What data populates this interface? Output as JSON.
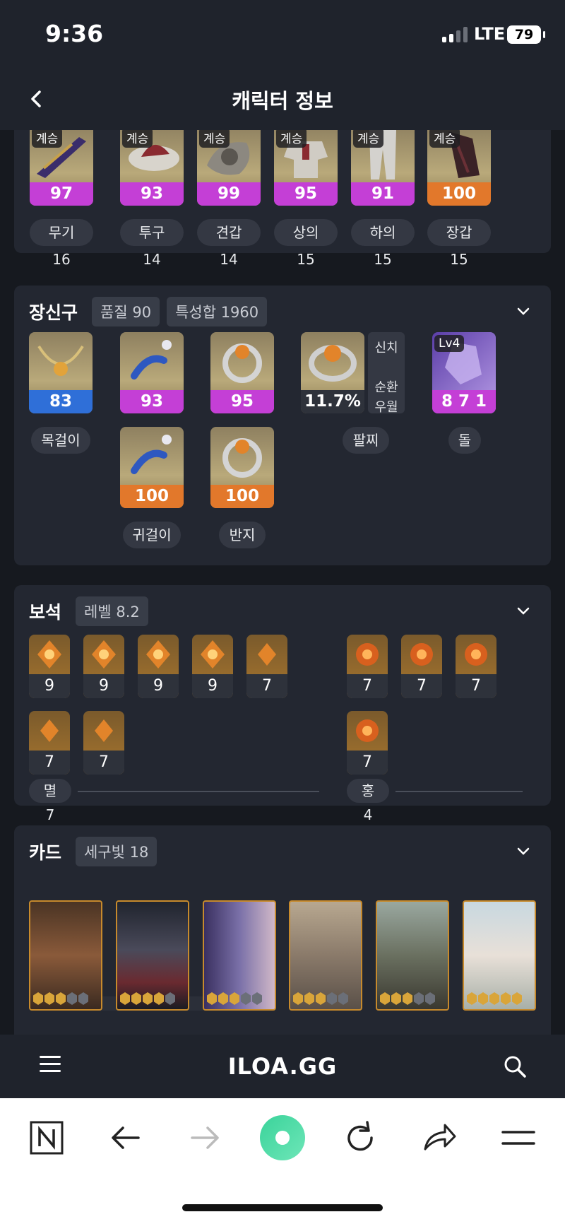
{
  "status": {
    "time": "9:36",
    "network": "LTE",
    "battery": "79"
  },
  "header": {
    "title": "캐릭터 정보"
  },
  "equipment": {
    "items": [
      {
        "badge": "계승",
        "quality": "97",
        "quality_color": "#c43fd6",
        "label": "무기 16"
      },
      {
        "badge": "계승",
        "quality": "93",
        "quality_color": "#c43fd6",
        "label": "투구 14"
      },
      {
        "badge": "계승",
        "quality": "99",
        "quality_color": "#c43fd6",
        "label": "견갑 14"
      },
      {
        "badge": "계승",
        "quality": "95",
        "quality_color": "#c43fd6",
        "label": "상의 15"
      },
      {
        "badge": "계승",
        "quality": "91",
        "quality_color": "#c43fd6",
        "label": "하의 15"
      },
      {
        "badge": "계승",
        "quality": "100",
        "quality_color": "#e2782b",
        "label": "장갑 15"
      }
    ]
  },
  "accessories": {
    "title": "장신구",
    "tags": [
      "품질 90",
      "특성합 1960"
    ],
    "necklace": {
      "quality": "83",
      "label": "목걸이"
    },
    "earrings": {
      "top_quality": "93",
      "bottom_quality": "100",
      "label": "귀걸이"
    },
    "rings": {
      "top_quality": "95",
      "bottom_quality": "100",
      "label": "반지"
    },
    "bracelet": {
      "value": "11.7%",
      "label": "팔찌",
      "effects": [
        "신치",
        "순환",
        "우월"
      ]
    },
    "stone": {
      "level": "Lv4",
      "value": "8 7 1",
      "label": "돌"
    }
  },
  "gems": {
    "title": "보석",
    "tag": "레벨 8.2",
    "left_row1": [
      "9",
      "9",
      "9",
      "9",
      "7"
    ],
    "left_row2": [
      "7",
      "7"
    ],
    "right_row1": [
      "7",
      "7",
      "7"
    ],
    "right_row2": [
      "7"
    ],
    "left_label": "멸 7",
    "right_label": "홍 4"
  },
  "cards": {
    "title": "카드",
    "tag": "세구빛 18",
    "awakenings": [
      3,
      4,
      3,
      3,
      3,
      5
    ]
  },
  "site": {
    "logo": "ILOA.GG"
  }
}
